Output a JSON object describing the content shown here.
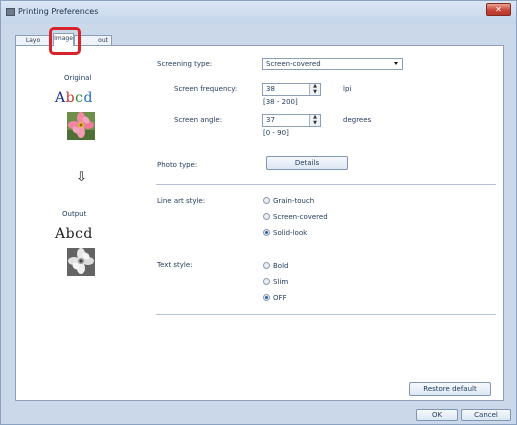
{
  "window": {
    "title": "Printing Preferences",
    "close_glyph": "✕"
  },
  "tabs": [
    {
      "label": "Layo"
    },
    {
      "label": "Image"
    },
    {
      "label": "out"
    }
  ],
  "preview": {
    "original_label": "Original",
    "abc_text_colored": [
      "A",
      "b",
      "c",
      "d"
    ],
    "arrow": "⇩",
    "output_label": "Output",
    "abc_text_output": "Abcd",
    "abc_colors": [
      "#1a2e8a",
      "#c0392b",
      "#2e8b3a",
      "#1f6fb8"
    ]
  },
  "screening": {
    "type_label": "Screening type:",
    "type_value": "Screen-covered",
    "frequency_label": "Screen frequency:",
    "frequency_value": "38",
    "frequency_unit": "lpi",
    "frequency_range": "[38 - 200]",
    "angle_label": "Screen angle:",
    "angle_value": "37",
    "angle_unit": "degrees",
    "angle_range": "[0 - 90]"
  },
  "photo": {
    "label": "Photo type:",
    "details_button": "Details"
  },
  "line_art": {
    "label": "Line art style:",
    "options": [
      {
        "label": "Grain-touch",
        "checked": false
      },
      {
        "label": "Screen-covered",
        "checked": false
      },
      {
        "label": "Solid-look",
        "checked": true
      }
    ]
  },
  "text_style": {
    "label": "Text style:",
    "options": [
      {
        "label": "Bold",
        "checked": false
      },
      {
        "label": "Slim",
        "checked": false
      },
      {
        "label": "OFF",
        "checked": true
      }
    ]
  },
  "buttons": {
    "restore_default": "Restore default",
    "ok": "OK",
    "cancel": "Cancel"
  }
}
